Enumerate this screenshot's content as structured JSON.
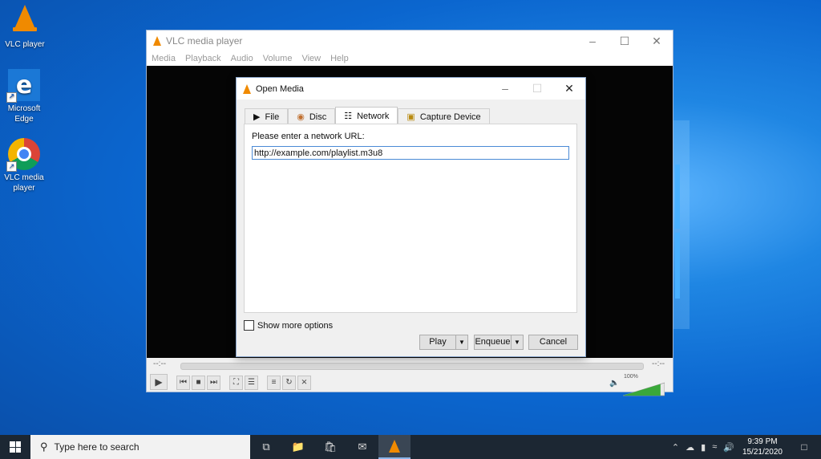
{
  "desktop": {
    "icons": [
      {
        "label": "VLC player",
        "icon": "vlc-cone-icon"
      },
      {
        "label": "Microsoft Edge",
        "icon": "edge-icon"
      },
      {
        "label": "VLC media player",
        "icon": "chrome-icon"
      }
    ]
  },
  "vlc": {
    "title": "VLC media player",
    "menu": [
      "Media",
      "Playback",
      "Audio",
      "Volume",
      "View",
      "Help"
    ],
    "time_left": "--:--",
    "time_right": "--:--",
    "volume_label": "100%",
    "volume_level": 1.0,
    "buttons": [
      "play-icon",
      "prev-icon",
      "stop-icon",
      "next-icon",
      "fullscreen-icon",
      "extended-settings-icon",
      "playlist-icon",
      "loop-icon",
      "shuffle-icon"
    ]
  },
  "dialog": {
    "title": "Open Media",
    "tabs": [
      {
        "label": "File",
        "icon": "file-icon",
        "active": false
      },
      {
        "label": "Disc",
        "icon": "disc-icon",
        "active": false
      },
      {
        "label": "Network",
        "icon": "network-icon",
        "active": true
      },
      {
        "label": "Capture Device",
        "icon": "capture-icon",
        "active": false
      }
    ],
    "prompt": "Please enter a network URL:",
    "url_value": "http://example.com/playlist.m3u8",
    "show_more": "Show more options",
    "play_label": "Play",
    "enqueue_label": "Enqueue",
    "cancel_label": "Cancel"
  },
  "taskbar": {
    "search_placeholder": "Type here to search",
    "time": "9:39 PM",
    "date": "15/21/2020"
  }
}
